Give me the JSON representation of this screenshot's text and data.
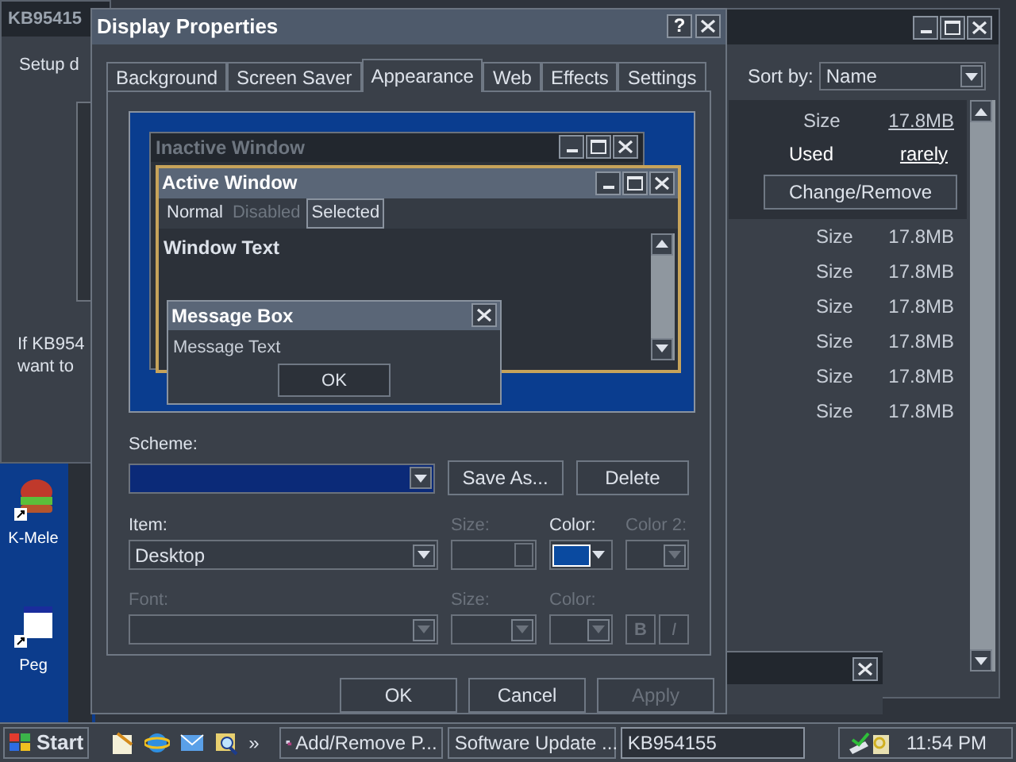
{
  "left_window": {
    "title": "KB95415",
    "text": "Setup d",
    "footer": [
      "If KB954",
      "want to"
    ]
  },
  "desktop_icons": [
    {
      "label": "K-Mele"
    },
    {
      "label": "Peg"
    }
  ],
  "apps_window": {
    "sort_label": "Sort by:",
    "sort_value": "Name",
    "selected_entry": {
      "size_label": "Size",
      "size": "17.8MB",
      "used_label": "Used",
      "used": "rarely",
      "button": "Change/Remove"
    },
    "rows": [
      {
        "label": "Size",
        "value": "17.8MB"
      },
      {
        "label": "Size",
        "value": "17.8MB"
      },
      {
        "label": "Size",
        "value": "17.8MB"
      },
      {
        "label": "Size",
        "value": "17.8MB"
      },
      {
        "label": "Size",
        "value": "17.8MB"
      },
      {
        "label": "Size",
        "value": "17.8MB"
      }
    ]
  },
  "dialog": {
    "title": "Display Properties",
    "help": "?",
    "tabs": [
      {
        "label": "Background",
        "selected": false
      },
      {
        "label": "Screen Saver",
        "selected": false
      },
      {
        "label": "Appearance",
        "selected": true
      },
      {
        "label": "Web",
        "selected": false
      },
      {
        "label": "Effects",
        "selected": false
      },
      {
        "label": "Settings",
        "selected": false
      }
    ],
    "preview": {
      "inactive_title": "Inactive Window",
      "active_title": "Active Window",
      "menu": [
        {
          "label": "Normal",
          "kind": "normal"
        },
        {
          "label": "Disabled",
          "kind": "disabled"
        },
        {
          "label": "Selected",
          "kind": "selected"
        }
      ],
      "window_text": "Window Text",
      "message_title": "Message Box",
      "message_text": "Message Text",
      "message_button": "OK"
    },
    "scheme": {
      "label": "Scheme:"
    },
    "scheme_buttons": [
      "Save As...",
      "Delete"
    ],
    "item": {
      "label": "Item:",
      "value": "Desktop"
    },
    "item_size": {
      "label": "Size:",
      "disabled": true
    },
    "item_color": {
      "label": "Color:",
      "color": "#0a4aa0",
      "disabled": false
    },
    "item_color2": {
      "label": "Color 2:",
      "disabled": true
    },
    "font": {
      "label": "Font:",
      "disabled": true
    },
    "font_size": {
      "label": "Size:",
      "disabled": true
    },
    "font_color": {
      "label": "Color:",
      "disabled": true
    },
    "style_buttons": [
      {
        "label": "B",
        "disabled": true
      },
      {
        "label": "I",
        "disabled": true
      }
    ],
    "buttons": [
      {
        "label": "OK",
        "disabled": false
      },
      {
        "label": "Cancel",
        "disabled": false
      },
      {
        "label": "Apply",
        "disabled": true
      }
    ]
  },
  "taskbar": {
    "start": "Start",
    "more": "»",
    "tasks": [
      {
        "label": "Add/Remove P...",
        "selected": false
      },
      {
        "label": "Software Update ...",
        "selected": false
      },
      {
        "label": "KB954155",
        "selected": true
      }
    ],
    "clock": "11:54 PM"
  }
}
